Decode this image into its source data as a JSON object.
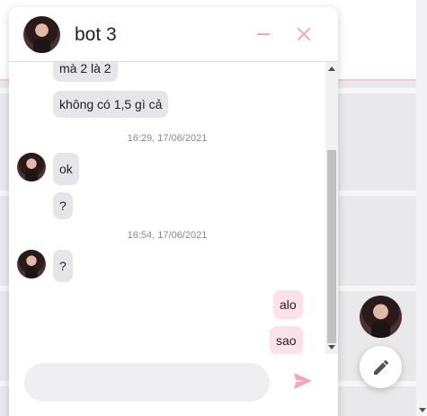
{
  "chat": {
    "title": "bot 3",
    "composer_placeholder": "",
    "messages": [
      {
        "text": "mà 2 là 2"
      },
      {
        "text": "không có 1,5 gì cả"
      },
      {
        "timestamp": "16:29, 17/06/2021"
      },
      {
        "text": "ok"
      },
      {
        "text": "?"
      },
      {
        "timestamp": "16:54, 17/06/2021"
      },
      {
        "text": "?"
      },
      {
        "text": "alo"
      },
      {
        "text": "sao"
      }
    ]
  },
  "icons": {
    "minimize": "minimize-icon",
    "close": "close-icon",
    "send": "send-icon",
    "edit": "pencil-icon"
  },
  "colors": {
    "accent": "#f4a6bb",
    "own_bubble": "#fce1ea",
    "other_bubble": "#e5e5ea"
  }
}
